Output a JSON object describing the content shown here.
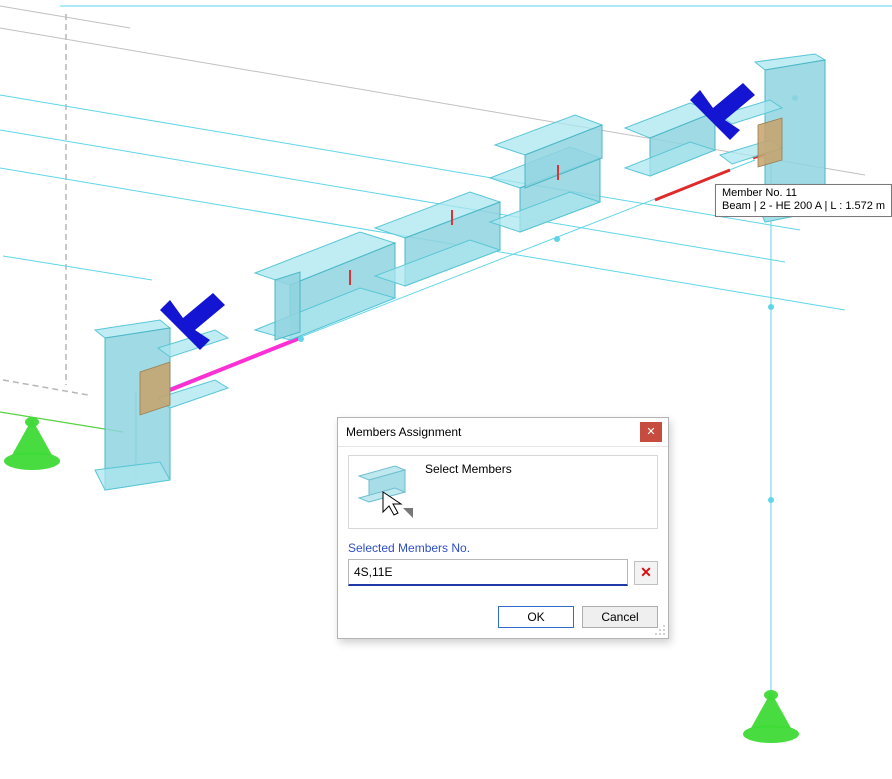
{
  "tooltip": {
    "line1": "Member No. 11",
    "line2": "Beam | 2 - HE 200 A | L : 1.572 m"
  },
  "dialog": {
    "title": "Members Assignment",
    "select_members_label": "Select Members",
    "selected_section_label": "Selected Members No.",
    "input_value": "4S,11E",
    "ok_label": "OK",
    "cancel_label": "Cancel",
    "close_glyph": "✕",
    "clear_glyph": "✕"
  },
  "colors": {
    "struct_line": "#5fd6e8",
    "beam_fill": "#abe5ef",
    "magenta": "#ff2fd6",
    "red": "#e02b2b",
    "support": "#3fda36",
    "arrow": "#1415d3",
    "dialog_close": "#c54c3f"
  }
}
